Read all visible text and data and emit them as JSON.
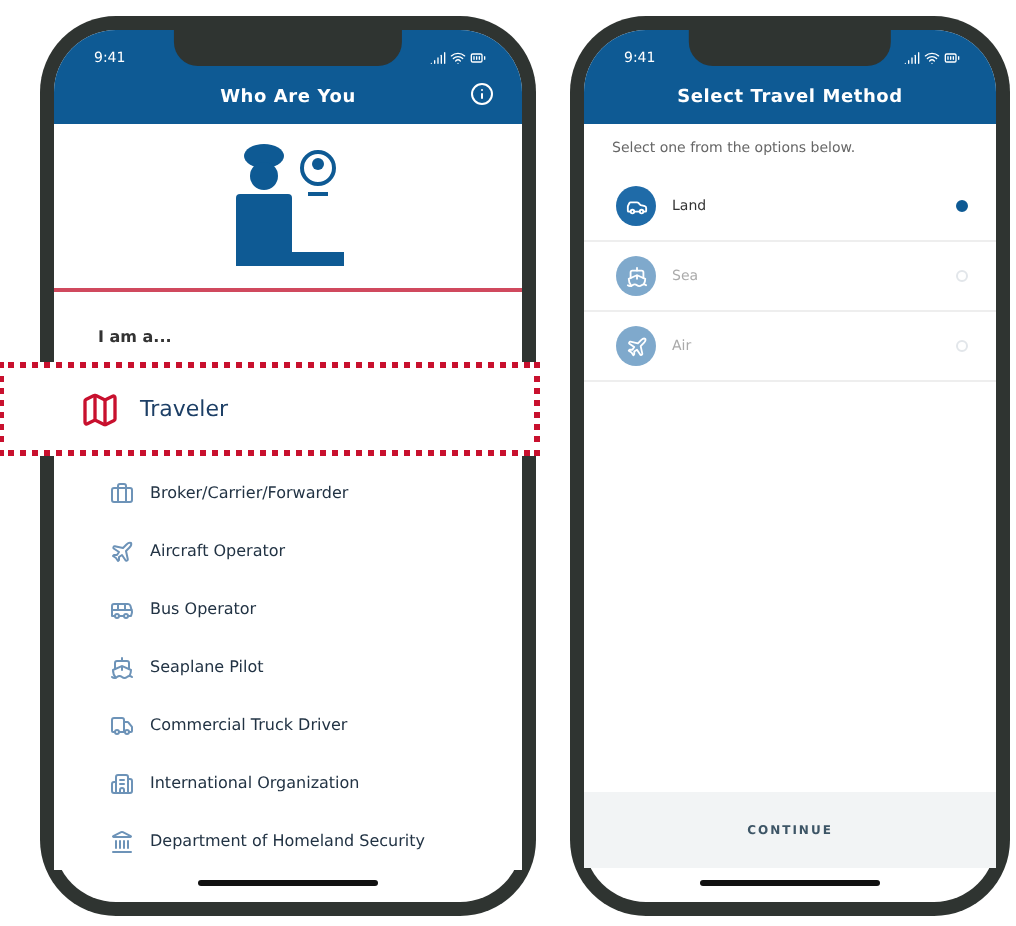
{
  "left_phone": {
    "status_bar": {
      "time": "9:41"
    },
    "header": {
      "title": "Who Are You"
    },
    "prompt": "I am a...",
    "roles": [
      {
        "label": "Traveler",
        "selected": true
      },
      {
        "label": "Broker/Carrier/Forwarder",
        "selected": false
      },
      {
        "label": "Aircraft Operator",
        "selected": false
      },
      {
        "label": "Bus Operator",
        "selected": false
      },
      {
        "label": "Seaplane Pilot",
        "selected": false
      },
      {
        "label": "Commercial Truck Driver",
        "selected": false
      },
      {
        "label": "International Organization",
        "selected": false
      },
      {
        "label": "Department of Homeland Security",
        "selected": false
      }
    ]
  },
  "right_phone": {
    "status_bar": {
      "time": "9:41"
    },
    "header": {
      "title": "Select Travel Method"
    },
    "instructions": "Select one from the options below.",
    "options": [
      {
        "label": "Land",
        "selected": true,
        "disabled": false
      },
      {
        "label": "Sea",
        "selected": false,
        "disabled": true
      },
      {
        "label": "Air",
        "selected": false,
        "disabled": true
      }
    ],
    "continue_button": "CONTINUE"
  }
}
